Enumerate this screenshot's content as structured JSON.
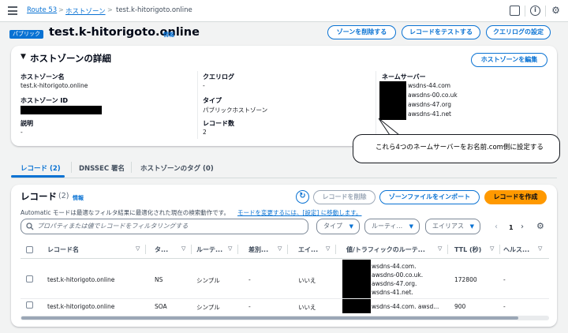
{
  "breadcrumb": {
    "root": "Route 53",
    "parent": "ホストゾーン",
    "current": "test.k-hitorigoto.online"
  },
  "header": {
    "badge": "パブリック",
    "title": "test.k-hitorigoto.online",
    "info": "情報",
    "buttons": {
      "delete_zone": "ゾーンを削除する",
      "test_record": "レコードをテストする",
      "query_log": "クエリログの設定"
    }
  },
  "details": {
    "title": "ホストゾーンの詳細",
    "edit_button": "ホストゾーンを編集",
    "zone_name_label": "ホストゾーン名",
    "zone_name_value": "test.k-hitorigoto.online",
    "zone_id_label": "ホストゾーン ID",
    "description_label": "説明",
    "description_value": "-",
    "query_log_label": "クエリログ",
    "query_log_value": "-",
    "type_label": "タイプ",
    "type_value": "パブリックホストゾーン",
    "record_count_label": "レコード数",
    "record_count_value": "2",
    "nameserver_label": "ネームサーバー",
    "nameservers": [
      "wsdns-44.com",
      "awsdns-00.co.uk",
      "awsdns-47.org",
      "awsdns-41.net"
    ]
  },
  "callout": "これら4つのネームサーバーをお名前.com側に設定する",
  "tabs": [
    "レコード (2)",
    "DNSSEC 署名",
    "ホストゾーンのタグ (0)"
  ],
  "records": {
    "title": "レコード",
    "count": "(2)",
    "info": "情報",
    "delete_button": "レコードを削除",
    "import_button": "ゾーンファイルをインポート",
    "create_button": "レコードを作成",
    "mode_text": "Automatic モードは最適なフィルタ結果に最適化された現在の検索動作です。",
    "mode_link": "モードを変更するには、[設定] に移動します。",
    "search_placeholder": "プロパティまたは値でレコードをフィルタリングする",
    "filters": {
      "type": "タイプ",
      "routing": "ルーティ...",
      "alias": "エイリアス"
    },
    "page": "1",
    "columns": [
      "レコード名",
      "タ...",
      "ルーテ...",
      "差別...",
      "エイ...",
      "値/トラフィックのルーテ...",
      "TTL (秒)",
      "ヘルス..."
    ],
    "rows": [
      {
        "name": "test.k-hitorigoto.online",
        "type": "NS",
        "routing": "シンプル",
        "diff": "-",
        "alias": "いいえ",
        "values": [
          "wsdns-44.com.",
          "awsdns-00.co.uk.",
          "awsdns-47.org.",
          "wsdns-41.net."
        ],
        "ttl": "172800",
        "health": "-"
      },
      {
        "name": "test.k-hitorigoto.online",
        "type": "SOA",
        "routing": "シンプル",
        "diff": "-",
        "alias": "いいえ",
        "values": [
          "wsdns-44.com. awsd..."
        ],
        "ttl": "900",
        "health": "-"
      }
    ]
  },
  "colors": {
    "accent": "#0972d3",
    "primary_button": "#ff9900",
    "badge": "#0972d3"
  },
  "icons": [
    "menu-icon",
    "panel-icon",
    "info-icon",
    "settings-icon",
    "refresh-icon",
    "search-icon",
    "caret-down-icon",
    "chevron-left-icon",
    "chevron-right-icon",
    "preferences-icon",
    "sort-icon"
  ]
}
